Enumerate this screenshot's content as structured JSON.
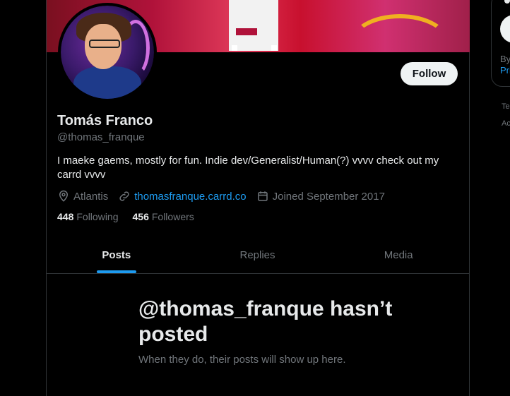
{
  "profile": {
    "display_name": "Tomás Franco",
    "handle": "@thomas_franque",
    "bio": "I maeke gaems, mostly for fun. Indie dev/Generalist/Human(?) vvvv check out my carrd vvvv",
    "location": "Atlantis",
    "website": "thomasfranque.carrd.co",
    "joined": "Joined September 2017",
    "following_count": "448",
    "following_label": "Following",
    "followers_count": "456",
    "followers_label": "Followers",
    "follow_button": "Follow"
  },
  "tabs": [
    {
      "label": "Posts",
      "active": true
    },
    {
      "label": "Replies",
      "active": false
    },
    {
      "label": "Media",
      "active": false
    }
  ],
  "empty_state": {
    "title": "@thomas_franque hasn’t posted",
    "subtitle": "When they do, their posts will show up here."
  },
  "right_panel": {
    "by_text": "By",
    "pri_text": "Pri",
    "footer_te": "Te",
    "footer_ac": "Ac"
  },
  "colors": {
    "background": "#000000",
    "text_primary": "#e7e9ea",
    "text_secondary": "#71767b",
    "accent": "#1d9bf0",
    "border": "#2f3336"
  },
  "icons": [
    "location-icon",
    "link-icon",
    "calendar-icon"
  ]
}
